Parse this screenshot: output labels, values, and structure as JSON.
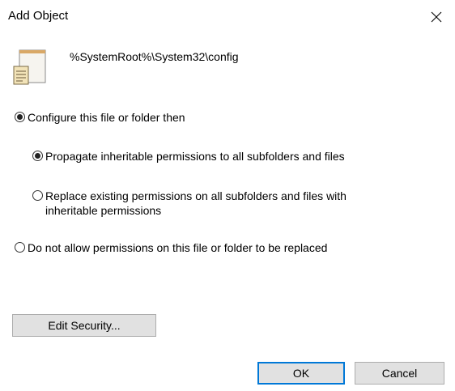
{
  "dialog": {
    "title": "Add Object",
    "path": "%SystemRoot%\\System32\\config"
  },
  "options": {
    "configure": "Configure this file or folder then",
    "propagate": "Propagate inheritable permissions to all subfolders and files",
    "replace_line1": "Replace existing permissions on all subfolders and files with",
    "replace_line2": "inheritable permissions",
    "do_not_allow": "Do not allow permissions on this file or folder to be replaced"
  },
  "selection": {
    "configure": true,
    "propagate": true,
    "replace": false,
    "do_not_allow": false
  },
  "buttons": {
    "edit_security": "Edit Security...",
    "ok": "OK",
    "cancel": "Cancel"
  },
  "icons": {
    "file": "document-icon",
    "close": "close-icon"
  }
}
